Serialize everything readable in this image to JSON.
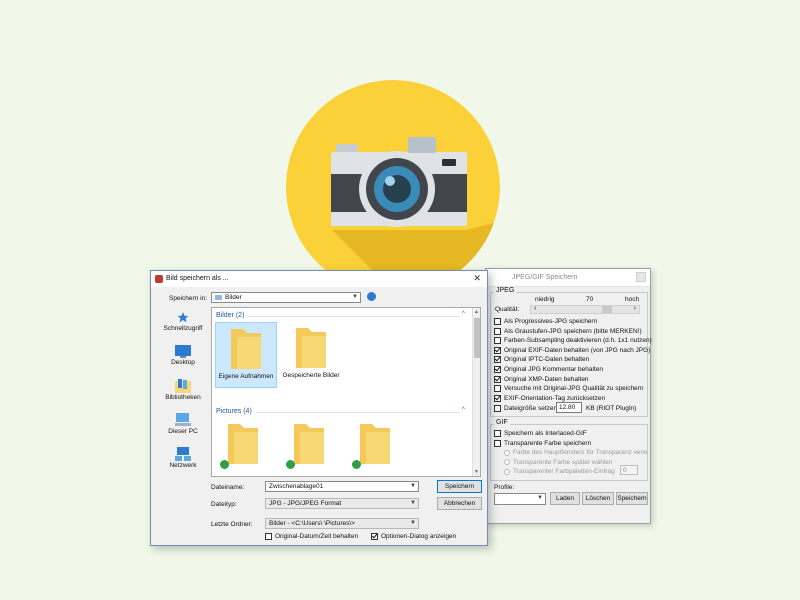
{
  "colors": {
    "background": "#f1f8e9",
    "badge_yellow": "#fbd13a",
    "badge_shadow": "#e2b420",
    "camera_body": "#41464d",
    "camera_top": "#dfe3e6",
    "lens_ring": "#3a8bb8",
    "folder_yellow": "#f8d775",
    "accent_blue": "#0078d7",
    "check_green": "#2ea043"
  },
  "save_dialog": {
    "title": "Bild speichern als ...",
    "save_in_label": "Speichern in:",
    "save_in_value": "Bilder",
    "places": [
      {
        "label": "Schnellzugriff",
        "icon": "star-icon"
      },
      {
        "label": "Desktop",
        "icon": "desktop-icon"
      },
      {
        "label": "Bibliotheken",
        "icon": "libraries-icon"
      },
      {
        "label": "Dieser PC",
        "icon": "computer-icon"
      },
      {
        "label": "Netzwerk",
        "icon": "network-icon"
      }
    ],
    "sections": [
      {
        "title": "Bilder (2)",
        "items": [
          "Eigene Aufnahmen",
          "Gespeicherte Bilder"
        ]
      },
      {
        "title": "Pictures (4)",
        "items": [
          "",
          "",
          ""
        ]
      }
    ],
    "filename_label": "Dateiname:",
    "filename_value": "Zwischenablage01",
    "filetype_label": "Dateityp:",
    "filetype_value": "JPG - JPG/JPEG Format",
    "last_folder_label": "Letzte Ordner:",
    "last_folder_value": "Bilder  -  <C:\\Users\\  \\Pictures\\>",
    "save_button": "Speichern",
    "cancel_button": "Abbrechen",
    "keep_date_label": "Original-Datum/Zeit behalten",
    "keep_date_checked": false,
    "show_options_label": "Optionen-Dialog anzeigen",
    "show_options_checked": true
  },
  "jpeg_panel": {
    "title": "JPEG/GIF Speichern",
    "jpeg_group": "JPEG",
    "quality_label": "Qualität:",
    "quality_low": "niedrig",
    "quality_value": "70",
    "quality_high": "hoch",
    "quality_fraction": 0.7,
    "options": [
      {
        "label": "Als Progressives-JPG speichern",
        "checked": false
      },
      {
        "label": "Als Graustufen-JPG speichern (bitte MERKEN!)",
        "checked": false
      },
      {
        "label": "Farben-Subsampling deaktivieren (d.h. 1x1 nutzen)",
        "checked": false
      },
      {
        "label": "Original EXIF-Daten behalten (von JPG nach JPG)",
        "checked": true
      },
      {
        "label": "Original IPTC-Daten behalten",
        "checked": true
      },
      {
        "label": "Original JPG Kommentar behalten",
        "checked": true
      },
      {
        "label": "Original XMP-Daten behalten",
        "checked": true
      },
      {
        "label": "Versuche mit Original-JPG Qualität zu speichern",
        "checked": false
      },
      {
        "label": "EXIF-Orientation-Tag zurücksetzen",
        "checked": true
      }
    ],
    "filesize_label": "Dateigröße setzen",
    "filesize_value": "12.80",
    "filesize_unit": "KB (RIOT PlugIn)",
    "gif_group": "GIF",
    "gif_options": [
      {
        "label": "Speichern als Interlaced-GIF",
        "checked": false
      },
      {
        "label": "Transparente Farbe speichern",
        "checked": false
      }
    ],
    "gif_radios": [
      "Farbe des Hauptfensters für Transparenz verw.",
      "Transparente Farbe später wählen",
      "Transparenter Farbpaletten-Eintrag"
    ],
    "palette_value": "0",
    "profile_label": "Profile:",
    "load_button": "Laden",
    "delete_button": "Löschen",
    "save_button": "Speichern"
  }
}
